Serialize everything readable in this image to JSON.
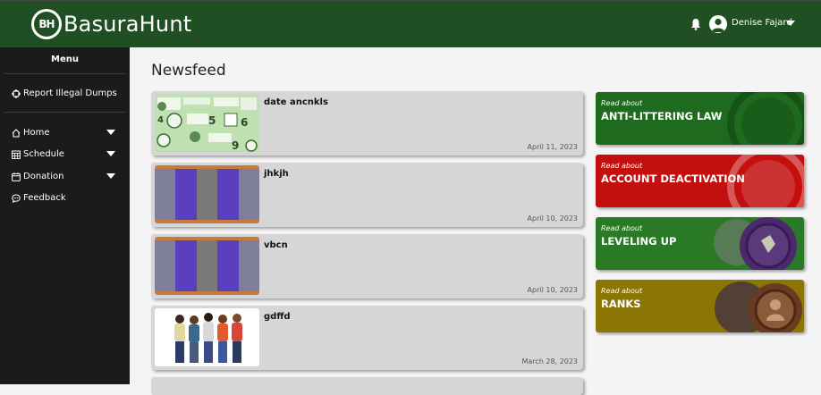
{
  "header": {
    "brand": "BasuraHunt",
    "logo_text": "BH",
    "user_name": "Denise Fajard",
    "icons": [
      "bell-icon",
      "user-avatar-icon",
      "caret-down-icon"
    ]
  },
  "sidebar": {
    "title": "Menu",
    "items": [
      {
        "label": "Report Illegal Dumps",
        "icon": "crosshair-icon"
      },
      {
        "label": "Home",
        "icon": "home-icon",
        "has_dropdown": true
      },
      {
        "label": "Schedule",
        "icon": "calendar-grid-icon",
        "has_dropdown": true
      },
      {
        "label": "Donation",
        "icon": "calendar-icon",
        "has_dropdown": true
      },
      {
        "label": "Feedback",
        "icon": "chat-icon"
      }
    ]
  },
  "main": {
    "title": "Newsfeed",
    "posts": [
      {
        "title": "date ancnkls",
        "date": "April 11, 2023",
        "thumb": "infographic"
      },
      {
        "title": "jhkjh",
        "date": "April 10, 2023",
        "thumb": "stripes"
      },
      {
        "title": "vbcn",
        "date": "April 10, 2023",
        "thumb": "stripes"
      },
      {
        "title": "gdffd",
        "date": "March 28, 2023",
        "thumb": "people"
      }
    ]
  },
  "read_about": {
    "prefix": "Read about",
    "tiles": [
      {
        "title": "ANTI-LITTERING LAW",
        "color": "#1e6a1e"
      },
      {
        "title": "ACCOUNT DEACTIVATION",
        "color": "#c40f0f"
      },
      {
        "title": "LEVELING UP",
        "color": "#2a7a25"
      },
      {
        "title": "RANKS",
        "color": "#8a7505"
      }
    ]
  },
  "colors": {
    "header_bg": "#214f24",
    "sidebar_bg": "#1b1b1b",
    "card_bg": "#d6d6d6",
    "page_bg": "#f4f4f4"
  }
}
